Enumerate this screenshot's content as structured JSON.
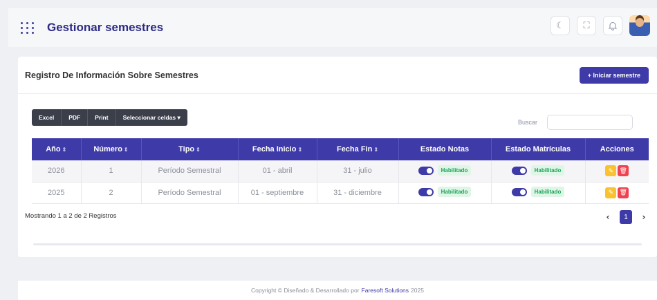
{
  "header": {
    "title": "Gestionar semestres",
    "menu_icon": "grid-dots-icon",
    "actions": [
      {
        "name": "theme-toggle-button",
        "icon": "moon-icon",
        "glyph": "☾"
      },
      {
        "name": "fullscreen-button",
        "icon": "fullscreen-icon",
        "glyph": "⛶"
      },
      {
        "name": "notifications-button",
        "icon": "bell-icon",
        "glyph": "🔔"
      }
    ]
  },
  "card": {
    "title": "Registro De Información Sobre Semestres",
    "add_button": "+ Iniciar semestre"
  },
  "toolbar": {
    "buttons": [
      "Excel",
      "PDF",
      "Print",
      "Seleccionar celdas ▾"
    ],
    "search_label": "Buscar",
    "search_value": ""
  },
  "table": {
    "columns": [
      "Año",
      "Número",
      "Tipo",
      "Fecha Inicio",
      "Fecha Fin",
      "Estado Notas",
      "Estado Matrículas",
      "Acciones"
    ],
    "rows": [
      {
        "anio": "2026",
        "numero": "1",
        "tipo": "Período Semestral",
        "inicio": "01 - abril",
        "fin": "31 - julio",
        "estado_notas": "Habilitado",
        "estado_matriculas": "Habilitado"
      },
      {
        "anio": "2025",
        "numero": "2",
        "tipo": "Período Semestral",
        "inicio": "01 - septiembre",
        "fin": "31 - diciembre",
        "estado_notas": "Habilitado",
        "estado_matriculas": "Habilitado"
      }
    ]
  },
  "pagination": {
    "info": "Mostrando 1 a 2 de 2 Registros",
    "prev": "‹",
    "current": "1",
    "next": "›"
  },
  "footer": {
    "prefix": "Copyright © Diseñado & Desarrollado por",
    "brand": "Faresoft Solutions",
    "year": "2025"
  },
  "colors": {
    "primary": "#3e3aa8",
    "success_badge": "#1aa35a",
    "edit": "#f9c22e",
    "delete": "#f0434f"
  }
}
